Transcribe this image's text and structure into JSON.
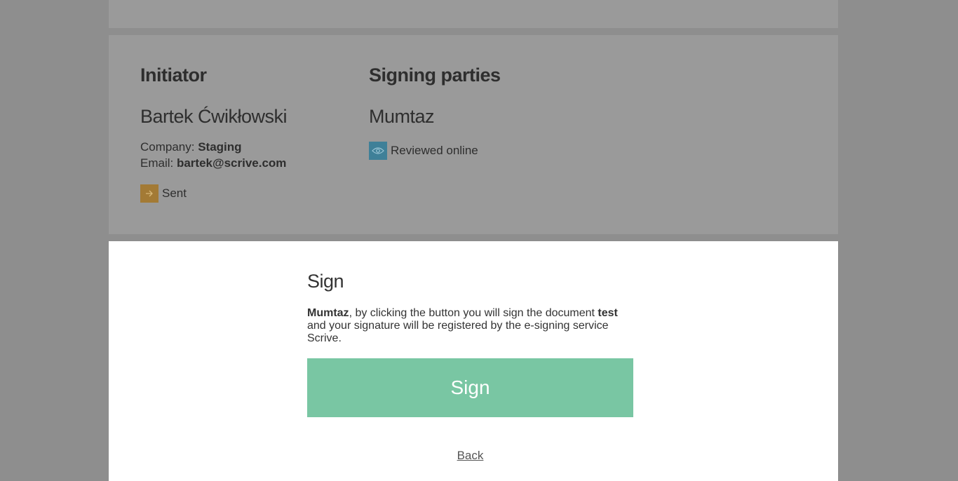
{
  "colors": {
    "overlay": "#8e8e8e",
    "panel": "#9a9a9a",
    "sent_status": "#a37a35",
    "reviewed_status": "#3f8098",
    "sign_button": "#79c6a3"
  },
  "initiator": {
    "heading": "Initiator",
    "name": "Bartek Ćwikłowski",
    "company_label": "Company:",
    "company_value": "Staging",
    "email_label": "Email:",
    "email_value": "bartek@scrive.com",
    "status_icon": "arrow-right-icon",
    "status_text": "Sent"
  },
  "signing_parties": {
    "heading": "Signing parties",
    "name": "Mumtaz",
    "status_icon": "eye-icon",
    "status_text": "Reviewed online"
  },
  "sign_modal": {
    "title": "Sign",
    "signer_name": "Mumtaz",
    "text_part1": ", by clicking the button you will sign the document ",
    "document_name": "test",
    "text_part2": " and your signature will be registered by the e-signing service Scrive.",
    "button_label": "Sign",
    "back_label": "Back"
  }
}
